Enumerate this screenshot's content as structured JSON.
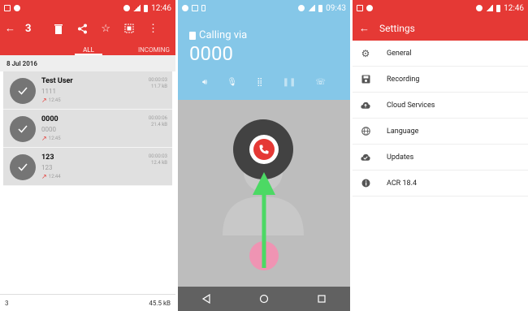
{
  "panel1": {
    "status": {
      "time": "12:46"
    },
    "toolbar": {
      "selected_count": "3"
    },
    "tabs": {
      "all": "ALL",
      "incoming": "INCOMING"
    },
    "date_header": "8 Jul 2016",
    "records": [
      {
        "name": "Test User",
        "number": "1111",
        "time": "12:45",
        "duration": "00:00:03",
        "size": "11.7 kB"
      },
      {
        "name": "0000",
        "number": "0000",
        "time": "12:45",
        "duration": "00:00:06",
        "size": "21.4 kB"
      },
      {
        "name": "123",
        "number": "123",
        "time": "12:44",
        "duration": "00:00:03",
        "size": "12.4 kB"
      }
    ],
    "footer": {
      "count": "3",
      "total_size": "45.5 kB"
    }
  },
  "panel2": {
    "status": {
      "time": "09:43"
    },
    "calling_via": "Calling via",
    "number": "0000"
  },
  "panel3": {
    "status": {
      "time": "12:46"
    },
    "title": "Settings",
    "items": [
      {
        "label": "General",
        "icon": "gear-icon"
      },
      {
        "label": "Recording",
        "icon": "save-icon"
      },
      {
        "label": "Cloud Services",
        "icon": "cloud-upload-icon"
      },
      {
        "label": "Language",
        "icon": "globe-icon"
      },
      {
        "label": "Updates",
        "icon": "cloud-check-icon"
      },
      {
        "label": "ACR 18.4",
        "icon": "info-icon"
      }
    ]
  },
  "colors": {
    "accent": "#e53935",
    "call_bg": "#85c7e8",
    "arrow": "#4cd964"
  }
}
